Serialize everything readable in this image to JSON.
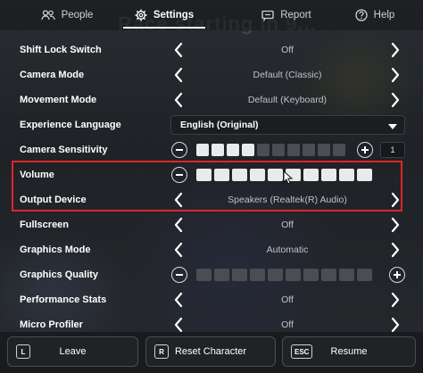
{
  "background_text": "Race starting in 9...",
  "tabs": [
    {
      "label": "People",
      "icon": "people-icon",
      "selected": false
    },
    {
      "label": "Settings",
      "icon": "gear-icon",
      "selected": true
    },
    {
      "label": "Report",
      "icon": "flag-icon",
      "selected": false
    },
    {
      "label": "Help",
      "icon": "question-icon",
      "selected": false
    }
  ],
  "settings": {
    "shift_lock": {
      "label": "Shift Lock Switch",
      "value": "Off"
    },
    "camera_mode": {
      "label": "Camera Mode",
      "value": "Default (Classic)"
    },
    "movement_mode": {
      "label": "Movement Mode",
      "value": "Default (Keyboard)"
    },
    "experience_language": {
      "label": "Experience Language",
      "value": "English (Original)"
    },
    "camera_sensitivity": {
      "label": "Camera Sensitivity",
      "value_text": "1",
      "level": 0.4,
      "segments": 10
    },
    "volume": {
      "label": "Volume",
      "level": 1.0,
      "segments": 10
    },
    "output_device": {
      "label": "Output Device",
      "value": "Speakers (Realtek(R) Audio)"
    },
    "fullscreen": {
      "label": "Fullscreen",
      "value": "Off"
    },
    "graphics_mode": {
      "label": "Graphics Mode",
      "value": "Automatic"
    },
    "graphics_quality": {
      "label": "Graphics Quality",
      "level": 0.0,
      "segments": 10
    },
    "performance_stats": {
      "label": "Performance Stats",
      "value": "Off"
    },
    "micro_profiler": {
      "label": "Micro Profiler",
      "value": "Off"
    }
  },
  "bottom": {
    "leave": {
      "key": "L",
      "label": "Leave"
    },
    "reset": {
      "key": "R",
      "label": "Reset Character"
    },
    "resume": {
      "key": "ESC",
      "label": "Resume"
    }
  },
  "colors": {
    "highlight_border": "#e0242c",
    "segment_on": "#e9eaec",
    "segment_off": "#4a4d52"
  }
}
